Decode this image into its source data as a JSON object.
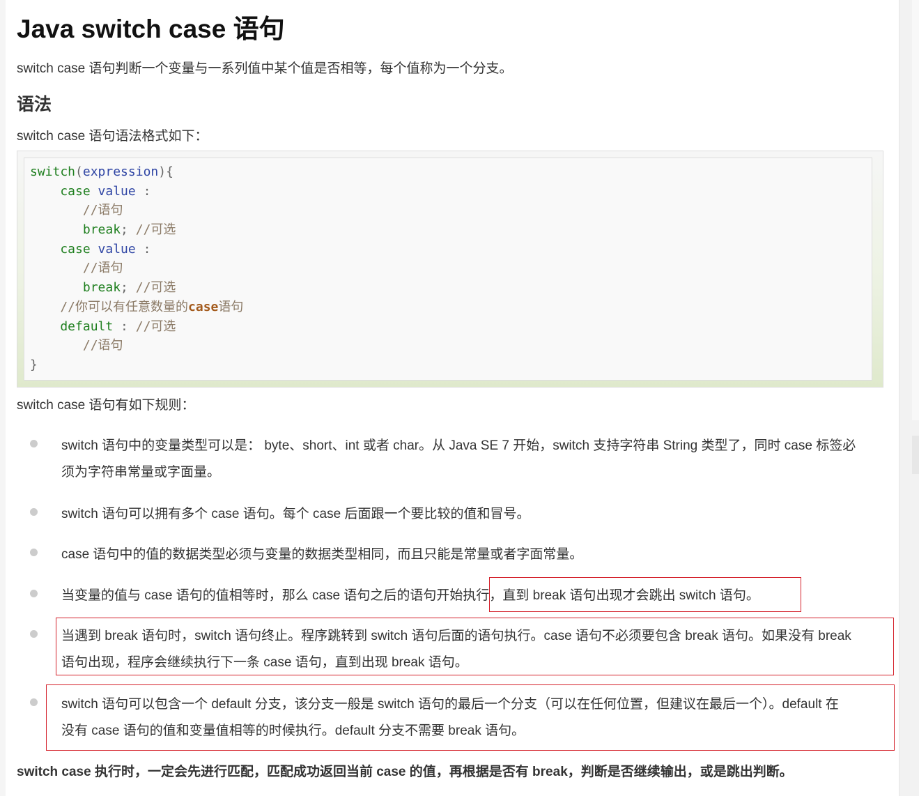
{
  "article": {
    "title": "Java switch case 语句",
    "intro": "switch case 语句判断一个变量与一系列值中某个值是否相等，每个值称为一个分支。",
    "syntax_heading": "语法",
    "syntax_intro": "switch case 语句语法格式如下：",
    "rules_intro": "switch case 语句有如下规则：",
    "rules": [
      {
        "lines": [
          "switch 语句中的变量类型可以是： byte、short、int 或者 char。从 Java SE 7 开始，switch 支持字符串 String 类型了，同时 case 标签必",
          "须为字符串常量或字面量。"
        ]
      },
      {
        "lines": [
          "switch 语句可以拥有多个 case 语句。每个 case 后面跟一个要比较的值和冒号。"
        ]
      },
      {
        "lines": [
          "case 语句中的值的数据类型必须与变量的数据类型相同，而且只能是常量或者字面常量。"
        ]
      },
      {
        "lines": [
          "当变量的值与 case 语句的值相等时，那么 case 语句之后的语句开始执行，直到 break 语句出现才会跳出 switch 语句。"
        ]
      },
      {
        "lines": [
          "当遇到 break 语句时，switch 语句终止。程序跳转到 switch 语句后面的语句执行。case 语句不必须要包含 break 语句。如果没有 break",
          "语句出现，程序会继续执行下一条 case 语句，直到出现 break 语句。"
        ]
      },
      {
        "lines": [
          "switch 语句可以包含一个 default 分支，该分支一般是 switch 语句的最后一个分支（可以在任何位置，但建议在最后一个）。default 在",
          "没有 case 语句的值和变量值相等的时候执行。default 分支不需要 break 语句。"
        ]
      }
    ],
    "summary": "switch case 执行时，一定会先进行匹配，匹配成功返回当前 case 的值，再根据是否有 break，判断是否继续输出，或是跳出判断。"
  },
  "code": {
    "lines": [
      [
        {
          "t": "switch",
          "k": "keyword"
        },
        {
          "t": "(",
          "k": "punctuation"
        },
        {
          "t": "expression",
          "k": "plain"
        },
        {
          "t": "){",
          "k": "punctuation"
        }
      ],
      [
        {
          "t": "    case",
          "k": "keyword"
        },
        {
          "t": " value",
          "k": "plain"
        },
        {
          "t": " :",
          "k": "punctuation"
        }
      ],
      [
        {
          "t": "       //语句",
          "k": "comment"
        }
      ],
      [
        {
          "t": "       break",
          "k": "keyword"
        },
        {
          "t": ";",
          "k": "punctuation"
        },
        {
          "t": " //可选",
          "k": "comment"
        }
      ],
      [
        {
          "t": "    case",
          "k": "keyword"
        },
        {
          "t": " value",
          "k": "plain"
        },
        {
          "t": " :",
          "k": "punctuation"
        }
      ],
      [
        {
          "t": "       //语句",
          "k": "comment"
        }
      ],
      [
        {
          "t": "       break",
          "k": "keyword"
        },
        {
          "t": ";",
          "k": "punctuation"
        },
        {
          "t": " //可选",
          "k": "comment"
        }
      ],
      [
        {
          "t": "    //你可以有任意数量的",
          "k": "comment"
        },
        {
          "t": "case",
          "k": "comment-keyword"
        },
        {
          "t": "语句",
          "k": "comment"
        }
      ],
      [
        {
          "t": "    default",
          "k": "keyword"
        },
        {
          "t": " :",
          "k": "punctuation"
        },
        {
          "t": " //可选",
          "k": "comment"
        }
      ],
      [
        {
          "t": "       //语句",
          "k": "comment"
        }
      ],
      [
        {
          "t": "}",
          "k": "punctuation"
        }
      ]
    ]
  },
  "colors": {
    "text": "#333333",
    "keyword": "#1f7f1f",
    "identifier": "#2f45a4",
    "punctuation": "#666666",
    "comment": "#8b7a66",
    "comment_keyword": "#a35a1c",
    "bullet": "#cccccc",
    "annotation": "#d4202a"
  }
}
